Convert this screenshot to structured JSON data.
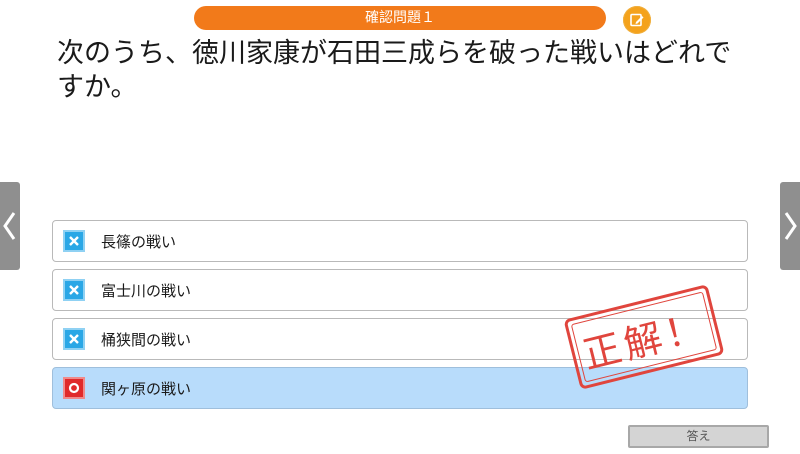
{
  "header": {
    "title": "確認問題１",
    "edit_icon": "edit-note-icon"
  },
  "question": {
    "text": "次のうち、徳川家康が石田三成らを破った戦いはどれですか。"
  },
  "options": [
    {
      "label": "長篠の戦い",
      "mark": "wrong",
      "icon": "cross-icon"
    },
    {
      "label": "富士川の戦い",
      "mark": "wrong",
      "icon": "cross-icon"
    },
    {
      "label": "桶狭間の戦い",
      "mark": "wrong",
      "icon": "cross-icon"
    },
    {
      "label": "関ヶ原の戦い",
      "mark": "correct",
      "icon": "circle-icon"
    }
  ],
  "stamp": {
    "text": "正解！",
    "color": "#e0453d"
  },
  "footer": {
    "answer_label": "答え"
  },
  "colors": {
    "accent": "#f27a1a",
    "correct_bg": "#b8dcfb",
    "wrong_mark": "#2aa7e6",
    "right_mark": "#e02a2a"
  }
}
